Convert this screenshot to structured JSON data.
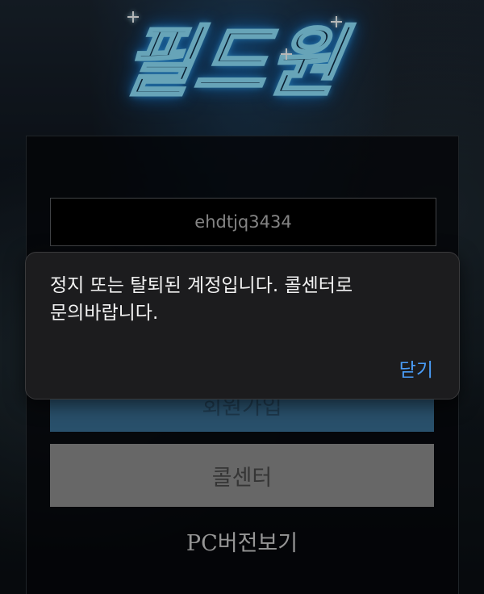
{
  "logo": {
    "text": "필드원"
  },
  "login": {
    "id_value": "ehdtjq3434",
    "signup_label": "회원가입",
    "callcenter_label": "콜센터",
    "pc_version_label": "PC버전보기"
  },
  "alert": {
    "message": "정지 또는 탈퇴된 계정입니다. 콜센터로 문의바랍니다.",
    "close_label": "닫기"
  },
  "colors": {
    "accent": "#4a9df8",
    "signup_button": "#3a6f95",
    "callcenter_button": "#8f8f8f",
    "dialog_background": "#1c1c1e"
  }
}
